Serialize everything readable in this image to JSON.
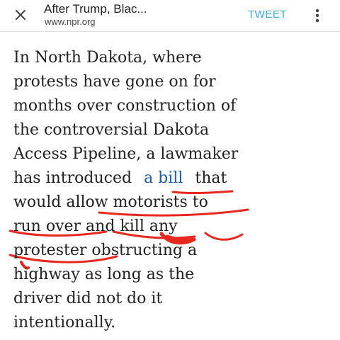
{
  "app_bar": {
    "title": "After Trump, Blac...",
    "url": "www.npr.org",
    "tweet_label": "TWEET",
    "close_icon": "close-icon",
    "menu_icon": "more-vertical-icon",
    "tweet_color": "#3aa8dc"
  },
  "article": {
    "lines": [
      "In North Dakota, where",
      "protests have gone on for",
      "months over construction of",
      "the controversial Dakota",
      "Access Pipeline, a lawmaker",
      "has introduced",
      "that",
      "would allow motorists to",
      "run over and kill any",
      "protester obstructing a",
      "highway as long as the",
      "driver did not do it",
      "intentionally."
    ],
    "link_text": "a bill",
    "link_color": "#1f5fa6",
    "annotation_color": "#e8281e"
  }
}
